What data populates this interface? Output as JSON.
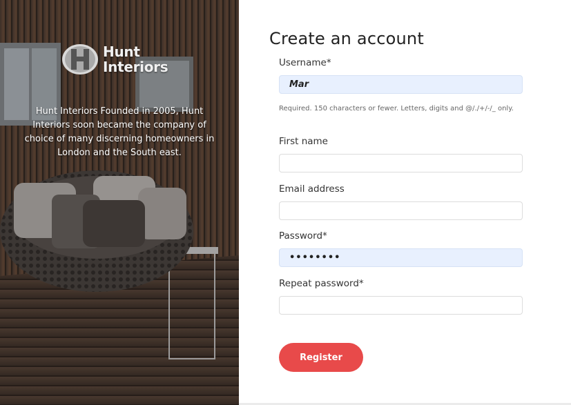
{
  "brand": {
    "logo_line1": "Hunt",
    "logo_line2": "Interiors",
    "blurb": "Hunt Interiors Founded in 2005, Hunt Interiors soon became the company of choice of many discerning homeowners in London and the South east."
  },
  "form": {
    "title": "Create an account",
    "fields": [
      {
        "label": "Username*",
        "value": "Mar",
        "autofilled": true
      },
      {
        "label": "First name",
        "value": ""
      },
      {
        "label": "Email address",
        "value": ""
      },
      {
        "label": "Password*",
        "value": "••••••••",
        "autofilled": true
      },
      {
        "label": "Repeat password*",
        "value": ""
      }
    ],
    "username_help": "Required. 150 characters or fewer. Letters, digits and @/./+/-/_ only.",
    "submit_label": "Register"
  },
  "colors": {
    "accent": "#e84a4a",
    "autofill_bg": "#e8f0fe"
  }
}
